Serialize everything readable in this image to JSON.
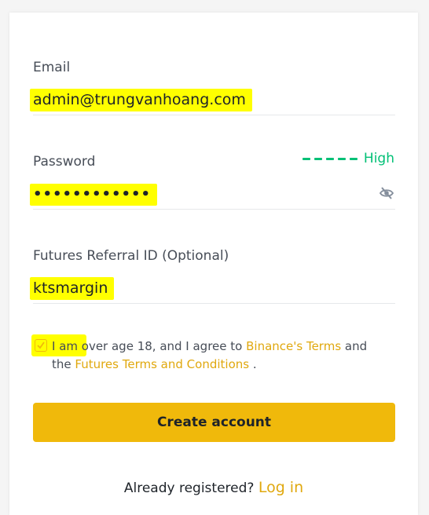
{
  "form": {
    "email_label": "Email",
    "email_value": "admin@trungvanhoang.com",
    "password_label": "Password",
    "password_value": "••••••••••••",
    "password_strength": "High",
    "referral_label": "Futures Referral ID (Optional)",
    "referral_value": "ktsmargin",
    "terms_part1": "I am over age 18, and I agree to ",
    "terms_link1": "Binance's Terms",
    "terms_part2": " and the ",
    "terms_link2": "Futures Terms and Conditions",
    "terms_part3": " .",
    "terms_checked": true,
    "create_button": "Create account",
    "already_registered": "Already registered?",
    "login_link": "Log in"
  },
  "colors": {
    "accent": "#f0b90b",
    "link": "#e0a80e",
    "strength": "#02c076",
    "highlight": "#ffff00"
  },
  "icons": {
    "password_toggle": "eye-slash-icon",
    "checkbox": "check-icon"
  }
}
